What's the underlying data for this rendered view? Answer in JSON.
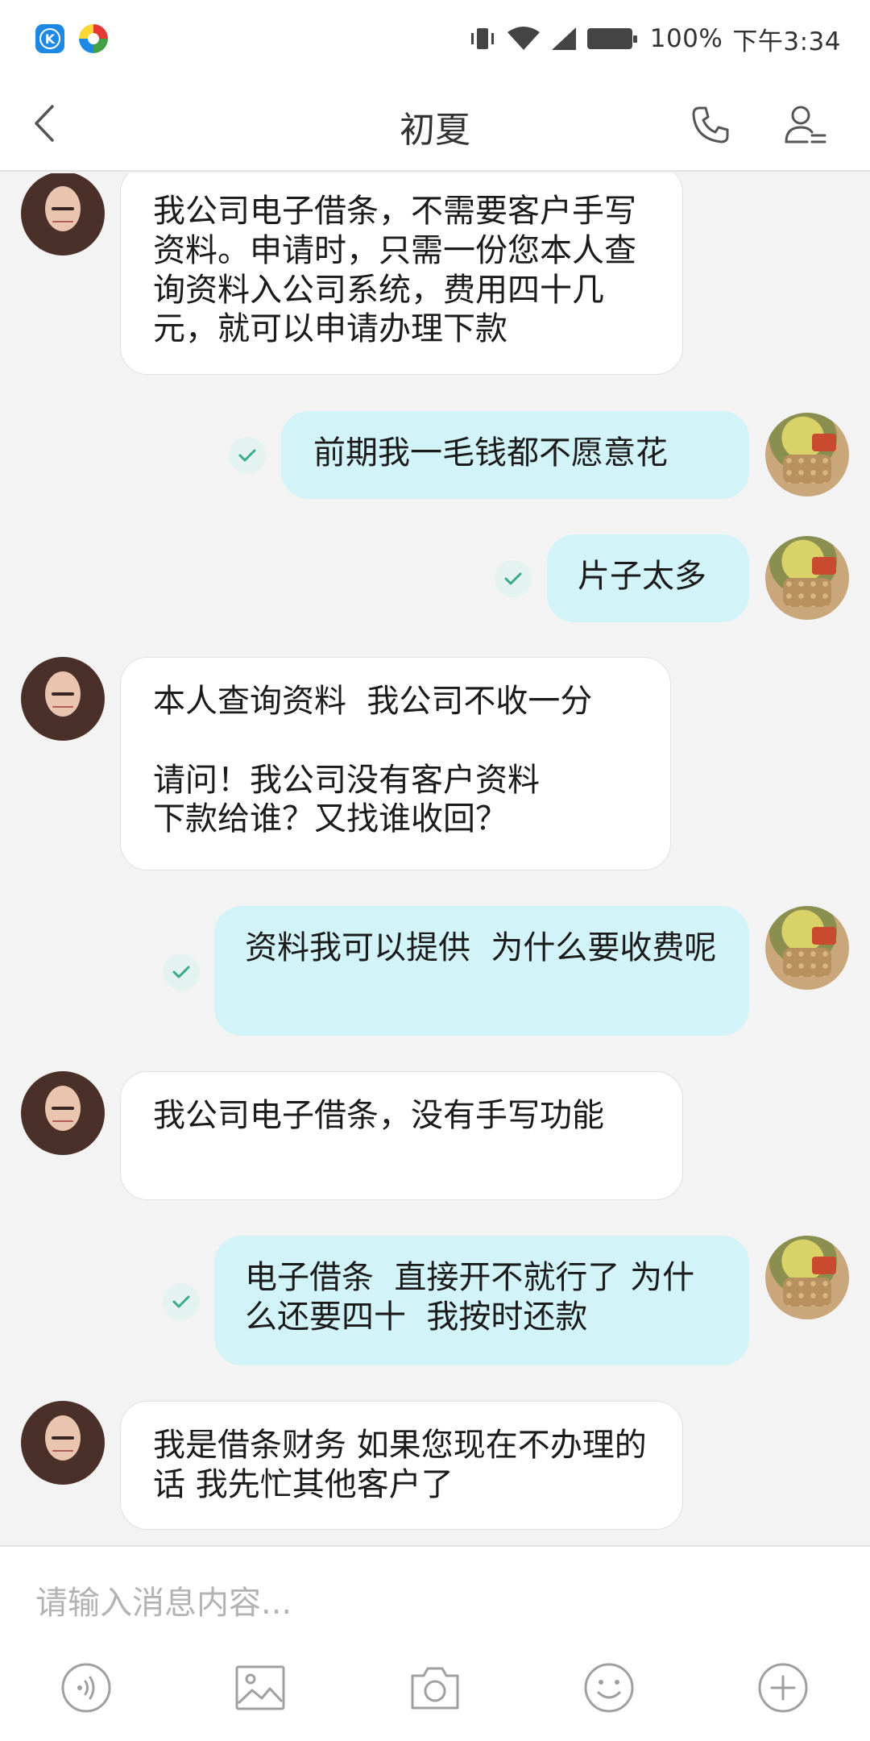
{
  "status_bar": {
    "battery": "100%",
    "time": "下午3:34"
  },
  "header": {
    "title": "初夏"
  },
  "messages": [
    {
      "side": "in",
      "text": "我公司电子借条，不需要客户手写资料。申请时，只需一份您本人查询资料入公司系统，费用四十几元，就可以申请办理下款"
    },
    {
      "side": "out",
      "text": "前期我一毛钱都不愿意花"
    },
    {
      "side": "out",
      "text": "片子太多"
    },
    {
      "side": "in",
      "text": "本人查询资料  我公司不收一分\n\n请问！我公司没有客户资料\n下款给谁？又找谁收回？"
    },
    {
      "side": "out",
      "text": "资料我可以提供  为什么要收费呢"
    },
    {
      "side": "in",
      "text": "我公司电子借条，没有手写功能"
    },
    {
      "side": "out",
      "text": "电子借条  直接开不就行了 为什么还要四十  我按时还款"
    },
    {
      "side": "in",
      "text": "我是借条财务 如果您现在不办理的话 我先忙其他客户了"
    }
  ],
  "input": {
    "placeholder": "请输入消息内容..."
  },
  "toolbar": [
    "voice-icon",
    "image-icon",
    "camera-icon",
    "emoji-icon",
    "plus-icon"
  ],
  "colors": {
    "background": "#f3f3f3",
    "outgoing_bubble": "#d2f4f8",
    "incoming_bubble": "#ffffff",
    "read_check": "#3aaa8a"
  }
}
